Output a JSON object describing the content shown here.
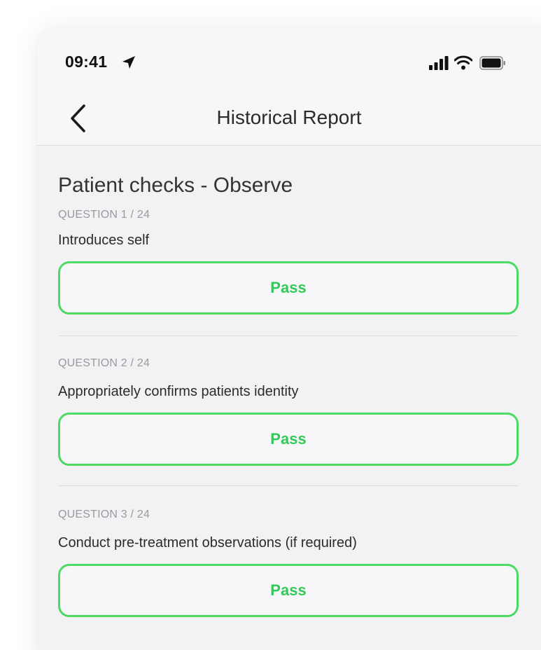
{
  "status_bar": {
    "time": "09:41",
    "icons": [
      "location-arrow-icon",
      "cellular-signal-icon",
      "wifi-icon",
      "battery-icon"
    ]
  },
  "nav": {
    "back_icon": "chevron-left-icon",
    "title": "Historical Report"
  },
  "section": {
    "title": "Patient checks - Observe"
  },
  "questions": [
    {
      "number": "QUESTION 1 / 24",
      "text": "Introduces self",
      "result": "Pass"
    },
    {
      "number": "QUESTION 2 / 24",
      "text": "Appropriately confirms patients identity",
      "result": "Pass"
    },
    {
      "number": "QUESTION 3 / 24",
      "text": "Conduct pre-treatment observations (if required)",
      "result": "Pass"
    }
  ],
  "colors": {
    "pass_green": "#34c759",
    "pass_border": "#4cd964",
    "background": "#f2f2f4"
  }
}
